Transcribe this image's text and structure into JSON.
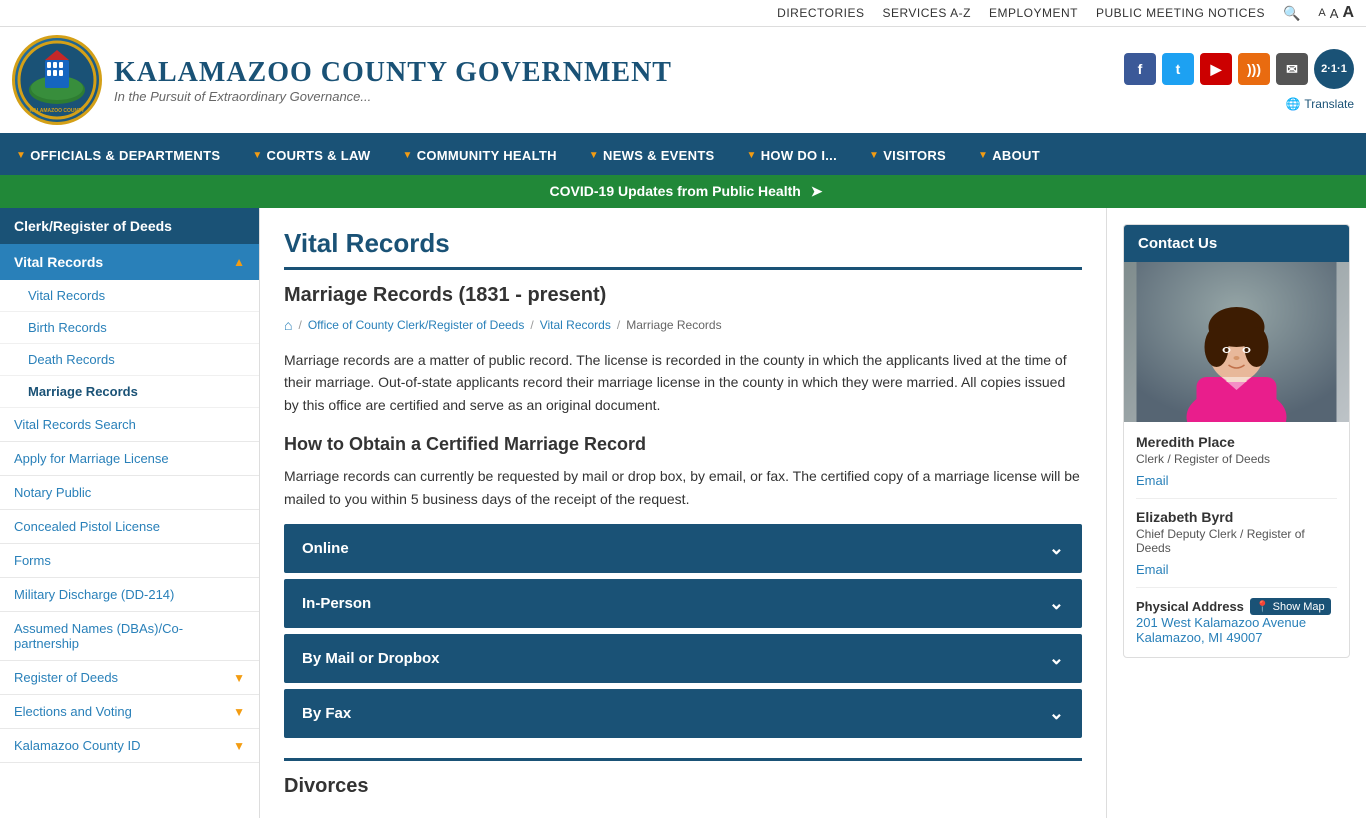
{
  "topbar": {
    "links": [
      "Directories",
      "Services A-Z",
      "Employment",
      "Public Meeting Notices"
    ],
    "font_sizes": [
      "A",
      "A",
      "A"
    ]
  },
  "header": {
    "title": "Kalamazoo County Government",
    "tagline": "In the Pursuit of Extraordinary Governance...",
    "translate_label": "Translate"
  },
  "nav": {
    "items": [
      {
        "label": "Officials & Departments",
        "has_dropdown": true
      },
      {
        "label": "Courts & Law",
        "has_dropdown": true
      },
      {
        "label": "Community Health",
        "has_dropdown": true
      },
      {
        "label": "News & Events",
        "has_dropdown": true
      },
      {
        "label": "How Do I...",
        "has_dropdown": true
      },
      {
        "label": "Visitors",
        "has_dropdown": true
      },
      {
        "label": "About",
        "has_dropdown": true
      }
    ]
  },
  "covid_banner": {
    "text": "COVID-19 Updates from Public Health"
  },
  "sidebar": {
    "section_title": "Clerk/Register of Deeds",
    "active_section": "Vital Records",
    "sub_items": [
      {
        "label": "Vital Records",
        "active": false
      },
      {
        "label": "Birth Records",
        "active": false
      },
      {
        "label": "Death Records",
        "active": false
      },
      {
        "label": "Marriage Records",
        "active": true
      }
    ],
    "items": [
      {
        "label": "Vital Records Search",
        "expandable": false
      },
      {
        "label": "Apply for Marriage License",
        "expandable": false
      },
      {
        "label": "Notary Public",
        "expandable": false
      },
      {
        "label": "Concealed Pistol License",
        "expandable": false
      },
      {
        "label": "Forms",
        "expandable": false
      },
      {
        "label": "Military Discharge (DD-214)",
        "expandable": false
      },
      {
        "label": "Assumed Names (DBAs)/Co-partnership",
        "expandable": false
      },
      {
        "label": "Register of Deeds",
        "expandable": true
      },
      {
        "label": "Elections and Voting",
        "expandable": true
      },
      {
        "label": "Kalamazoo County ID",
        "expandable": true
      }
    ]
  },
  "main": {
    "page_title": "Vital Records",
    "section_title": "Marriage Records (1831 - present)",
    "breadcrumb": {
      "home": "",
      "crumbs": [
        "Office of County Clerk/Register of Deeds",
        "Vital Records",
        "Marriage Records"
      ]
    },
    "intro": "Marriage records are a matter of public record. The license is recorded in the county in which the applicants lived at the time of their marriage. Out-of-state applicants record their marriage license in the county in which they were married. All copies issued by this office are certified and serve as an original document.",
    "how_to_heading": "How to Obtain a Certified Marriage Record",
    "how_to_text": "Marriage records can currently be requested by mail or drop box, by email, or fax. The certified copy of a marriage license will be mailed to you within 5 business days of the receipt of the request.",
    "accordion_items": [
      {
        "label": "Online"
      },
      {
        "label": "In-Person"
      },
      {
        "label": "By Mail or Dropbox"
      },
      {
        "label": "By Fax"
      }
    ],
    "divorces_heading": "Divorces"
  },
  "contact": {
    "heading": "Contact Us",
    "person1": {
      "name": "Meredith Place",
      "role": "Clerk / Register of Deeds",
      "email_label": "Email"
    },
    "person2": {
      "name": "Elizabeth Byrd",
      "role": "Chief Deputy Clerk / Register of Deeds",
      "email_label": "Email"
    },
    "address": {
      "label": "Physical Address",
      "show_map": "Show Map",
      "line1": "201 West Kalamazoo Avenue",
      "line2": "Kalamazoo, MI 49007"
    }
  }
}
